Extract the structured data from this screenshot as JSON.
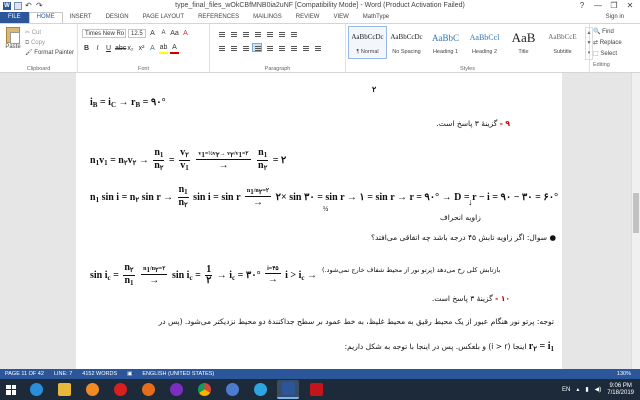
{
  "window": {
    "title": "type_final_files_wOkCBfMNB0ia2uNF [Compatibility Mode] - Word (Product Activation Failed)",
    "controls": [
      "?",
      "—",
      "❐",
      "✕"
    ]
  },
  "tabs": [
    "FILE",
    "HOME",
    "INSERT",
    "DESIGN",
    "PAGE LAYOUT",
    "REFERENCES",
    "MAILINGS",
    "REVIEW",
    "VIEW",
    "MathType"
  ],
  "signin": "Sign in",
  "ribbon": {
    "clipboard": {
      "paste": "Paste",
      "cut": "Cut",
      "copy": "Copy",
      "format_painter": "Format Painter",
      "label": "Clipboard"
    },
    "font": {
      "name": "Times New Ro",
      "size": "12.5",
      "label": "Font"
    },
    "paragraph": {
      "label": "Paragraph"
    },
    "styles": {
      "label": "Styles",
      "items": [
        {
          "sample": "AaBbCcDc",
          "name": "¶ Normal"
        },
        {
          "sample": "AaBbCcDc",
          "name": "No Spacing"
        },
        {
          "sample": "AaBbC",
          "name": "Heading 1"
        },
        {
          "sample": "AaBbCcl",
          "name": "Heading 2"
        },
        {
          "sample": "AaB",
          "name": "Title"
        },
        {
          "sample": "AaBbCcE",
          "name": "Subtitle"
        }
      ]
    },
    "editing": {
      "find": "Find",
      "replace": "Replace",
      "select": "Select",
      "label": "Editing"
    }
  },
  "document": {
    "top_num": "۲",
    "eq1": "i = i → r = ۹۰°",
    "q9_num": "۹ -",
    "q9_text": "گزینهٔ ۳ پاسخ است.",
    "q10_num": "۱۰ -",
    "q10_text": "گزینهٔ ۳ پاسخ است.",
    "question": "سوال: اگر زاویه تابش ۴۵ درجه باشد چه اتفاقی می‌افتد؟",
    "tir_note": "بازتابش کلی رخ می‌دهد (پرتو نور از محیط شفاف خارج نمی‌شود.)",
    "refraction_angle": "زاویه انحراف",
    "explanation1": "توجه: پرتو نور هنگام عبور از یک محیط رقیق به محیط غلیظ، به خط عمود بر سطح جداکنندهٔ دو محیط نزدیکتر می‌شود. (پس در",
    "explanation2": "اینجا (i > r) و بلعکس. پس در اینجا با توجه به شکل داریم:"
  },
  "status": {
    "page": "PAGE 11 OF 42",
    "line": "LINE: 7",
    "words": "4152 WORDS",
    "lang": "ENGLISH (UNITED STATES)",
    "zoom": "130%"
  },
  "taskbar": {
    "lang": "EN",
    "time": "9:06 PM",
    "date": "7/18/2019"
  }
}
